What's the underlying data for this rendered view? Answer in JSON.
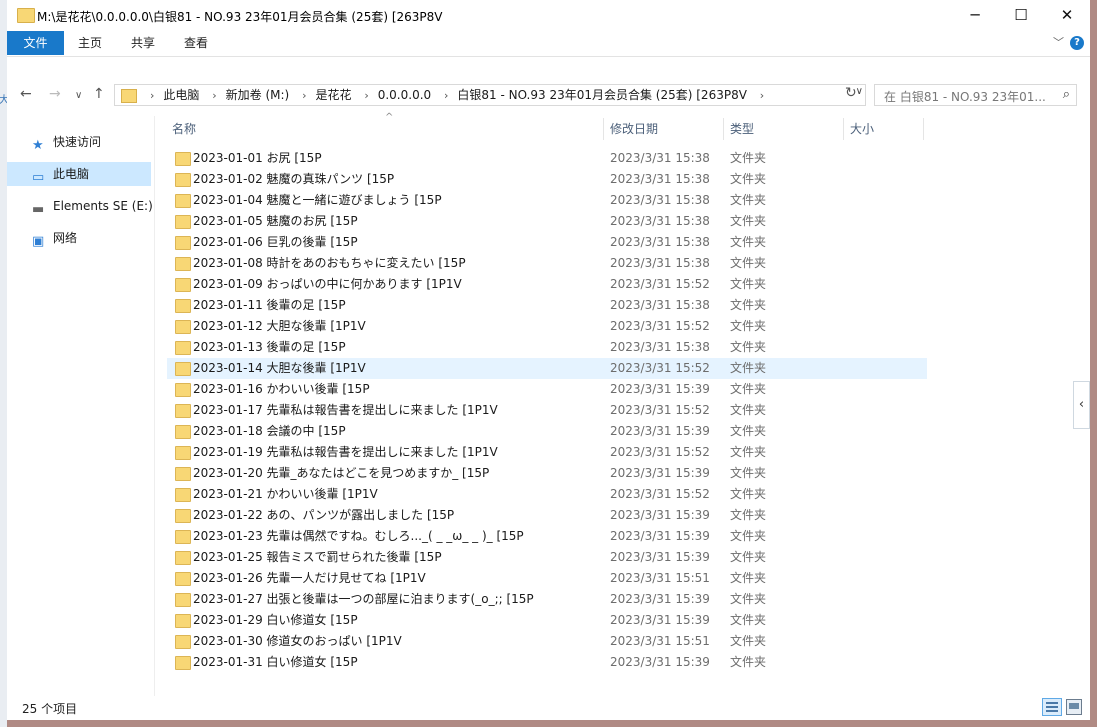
{
  "window": {
    "title": "M:\\是花花\\0.0.0.0.0\\白银81 - NO.93 23年01月会员合集 (25套) [263P8V",
    "controls": {
      "minimize": "─",
      "maximize": "☐",
      "close": "✕"
    }
  },
  "ribbon": {
    "file_label": "文件",
    "tabs": [
      "主页",
      "共享",
      "查看"
    ],
    "expand_glyph": "﹀",
    "help_glyph": "?"
  },
  "nav": {
    "back": "←",
    "forward": "→",
    "up": "↑",
    "breadcrumbs": [
      "此电脑",
      "新加卷 (M:)",
      "是花花",
      "0.0.0.0.0",
      "白银81 - NO.93 23年01月会员合集 (25套) [263P8V"
    ],
    "sep": "›",
    "dropdown": "∨",
    "refresh": "↻",
    "search_placeholder": "在 白银81 - NO.93 23年01...",
    "search_icon": "⌕"
  },
  "sidebar": {
    "items": [
      {
        "label": "快速访问",
        "icon": "★",
        "icon_color": "#2f7fd4"
      },
      {
        "label": "此电脑",
        "icon": "▭",
        "icon_color": "#2f7fd4",
        "selected": true
      },
      {
        "label": "Elements SE (E:)",
        "icon": "▬",
        "icon_color": "#666"
      },
      {
        "label": "网络",
        "icon": "▣",
        "icon_color": "#2f7fd4"
      }
    ]
  },
  "columns": {
    "name": "名称",
    "date": "修改日期",
    "type": "类型",
    "size": "大小",
    "sort_glyph": "^"
  },
  "files": [
    {
      "name": "2023-01-01 お尻 [15P",
      "date": "2023/3/31 15:38",
      "type": "文件夹"
    },
    {
      "name": "2023-01-02 魅魔の真珠パンツ [15P",
      "date": "2023/3/31 15:38",
      "type": "文件夹"
    },
    {
      "name": "2023-01-04 魅魔と一緒に遊びましょう [15P",
      "date": "2023/3/31 15:38",
      "type": "文件夹"
    },
    {
      "name": "2023-01-05 魅魔のお尻 [15P",
      "date": "2023/3/31 15:38",
      "type": "文件夹"
    },
    {
      "name": "2023-01-06 巨乳の後輩 [15P",
      "date": "2023/3/31 15:38",
      "type": "文件夹"
    },
    {
      "name": "2023-01-08 時計をあのおもちゃに変えたい [15P",
      "date": "2023/3/31 15:38",
      "type": "文件夹"
    },
    {
      "name": "2023-01-09 おっぱいの中に何かあります [1P1V",
      "date": "2023/3/31 15:52",
      "type": "文件夹"
    },
    {
      "name": "2023-01-11 後輩の足 [15P",
      "date": "2023/3/31 15:38",
      "type": "文件夹"
    },
    {
      "name": "2023-01-12 大胆な後輩 [1P1V",
      "date": "2023/3/31 15:52",
      "type": "文件夹"
    },
    {
      "name": "2023-01-13 後輩の足 [15P",
      "date": "2023/3/31 15:38",
      "type": "文件夹"
    },
    {
      "name": "2023-01-14 大胆な後輩 [1P1V",
      "date": "2023/3/31 15:52",
      "type": "文件夹",
      "hover": true
    },
    {
      "name": "2023-01-16 かわいい後輩 [15P",
      "date": "2023/3/31 15:39",
      "type": "文件夹"
    },
    {
      "name": "2023-01-17 先輩私は報告書を提出しに来ました [1P1V",
      "date": "2023/3/31 15:52",
      "type": "文件夹"
    },
    {
      "name": "2023-01-18 会議の中 [15P",
      "date": "2023/3/31 15:39",
      "type": "文件夹"
    },
    {
      "name": "2023-01-19 先輩私は報告書を提出しに来ました [1P1V",
      "date": "2023/3/31 15:52",
      "type": "文件夹"
    },
    {
      "name": "2023-01-20 先輩_あなたはどこを見つめますか_ [15P",
      "date": "2023/3/31 15:39",
      "type": "文件夹"
    },
    {
      "name": "2023-01-21 かわいい後輩 [1P1V",
      "date": "2023/3/31 15:52",
      "type": "文件夹"
    },
    {
      "name": "2023-01-22 あの、パンツが露出しました [15P",
      "date": "2023/3/31 15:39",
      "type": "文件夹"
    },
    {
      "name": "2023-01-23 先輩は偶然ですね。むしろ..._( _ _ω_ _ )_ [15P",
      "date": "2023/3/31 15:39",
      "type": "文件夹"
    },
    {
      "name": "2023-01-25 報告ミスで罰せられた後輩 [15P",
      "date": "2023/3/31 15:39",
      "type": "文件夹"
    },
    {
      "name": "2023-01-26 先輩一人だけ見せてね [1P1V",
      "date": "2023/3/31 15:51",
      "type": "文件夹"
    },
    {
      "name": "2023-01-27 出張と後輩は一つの部屋に泊まります(_o_;; [15P",
      "date": "2023/3/31 15:39",
      "type": "文件夹"
    },
    {
      "name": "2023-01-29 白い修道女 [15P",
      "date": "2023/3/31 15:39",
      "type": "文件夹"
    },
    {
      "name": "2023-01-30 修道女のおっぱい [1P1V",
      "date": "2023/3/31 15:51",
      "type": "文件夹"
    },
    {
      "name": "2023-01-31 白い修道女 [15P",
      "date": "2023/3/31 15:39",
      "type": "文件夹"
    }
  ],
  "status": {
    "count_text": "25 个项目"
  },
  "side_tab_glyph": "‹",
  "left_strip_glyph": "大",
  "colors": {
    "accent": "#1979ca",
    "selection": "#cce8ff",
    "hover_row": "#e5f3ff",
    "folder": "#f8d775"
  }
}
